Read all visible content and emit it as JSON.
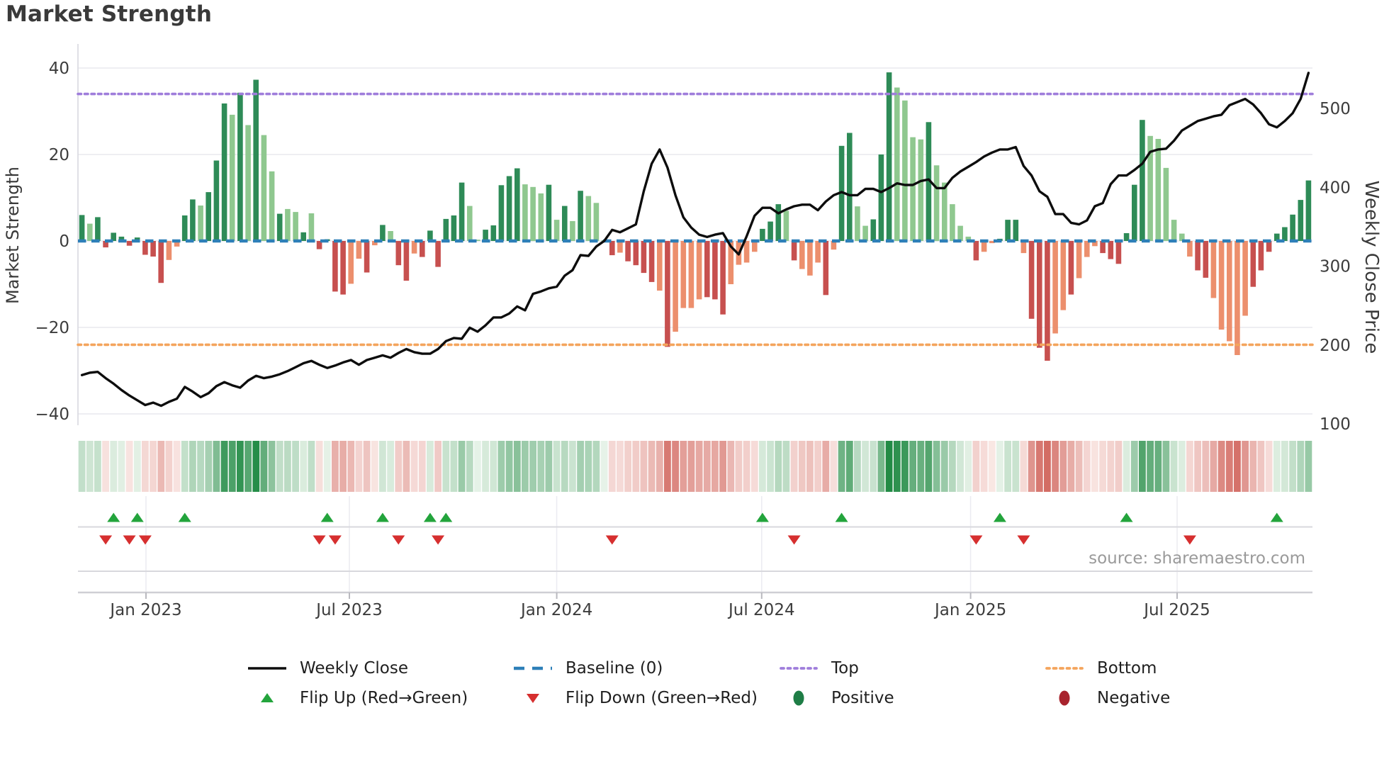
{
  "title": "Market Strength",
  "source": "source: sharemaestro.com",
  "axes": {
    "left_title": "Market Strength",
    "right_title": "Weekly Close Price",
    "left_ticks": [
      40,
      20,
      0,
      -20,
      -40
    ],
    "right_ticks": [
      500,
      400,
      300,
      200,
      100
    ],
    "x_ticks": [
      {
        "week": 8.1,
        "label": "Jan 2023"
      },
      {
        "week": 33.8,
        "label": "Jul 2023"
      },
      {
        "week": 60.0,
        "label": "Jan 2024"
      },
      {
        "week": 85.9,
        "label": "Jul 2024"
      },
      {
        "week": 112.3,
        "label": "Jan 2025"
      },
      {
        "week": 138.4,
        "label": "Jul 2025"
      }
    ]
  },
  "chart_data": {
    "type": "bar",
    "title": "Market Strength",
    "ylabel": "Market Strength",
    "y2label": "Weekly Close Price",
    "ylim": [
      -42.6,
      45.6
    ],
    "y2lim": [
      99,
      584
    ],
    "baseline": 0,
    "top_line": 34,
    "bottom_line": -24,
    "grid": true,
    "legend_position": "bottom",
    "x_start": "Nov 2022",
    "x_end": "Oct 2025",
    "series": [
      {
        "name": "Market Strength (weekly bars)",
        "values": [
          6,
          4,
          5.5,
          -1.5,
          1.9,
          1.0,
          -1.1,
          0.8,
          -3.2,
          -3.6,
          -9.7,
          -4.4,
          -1.3,
          5.9,
          9.6,
          8.2,
          11.3,
          18.6,
          31.8,
          29.2,
          34.3,
          26.8,
          37.3,
          24.5,
          16.1,
          6.3,
          7.4,
          6.7,
          2.0,
          6.4,
          -1.9,
          0.4,
          -11.7,
          -12.4,
          -9.9,
          -4.1,
          -7.3,
          -1.0,
          3.7,
          2.3,
          -5.6,
          -9.2,
          -2.9,
          -3.7,
          2.4,
          -6.0,
          5.1,
          5.9,
          13.5,
          8.1,
          0.3,
          2.6,
          3.6,
          12.9,
          15.0,
          16.8,
          13.1,
          12.5,
          11.0,
          13.0,
          4.9,
          8.1,
          4.6,
          11.6,
          10.4,
          8.8,
          0.2,
          -3.3,
          -2.7,
          -4.7,
          -5.6,
          -7.4,
          -9.5,
          -11.5,
          -24.5,
          -21.0,
          -15.5,
          -15.5,
          -13.5,
          -13.0,
          -13.5,
          -17.0,
          -10.0,
          -5.5,
          -5.0,
          -2.5,
          2.8,
          4.5,
          8.5,
          7.0,
          -4.5,
          -6.5,
          -8.0,
          -5.0,
          -12.5,
          -2.0,
          22.0,
          25.0,
          8.0,
          3.5,
          5.0,
          20.0,
          39.0,
          35.5,
          32.5,
          24.0,
          23.5,
          27.5,
          17.5,
          13.5,
          8.5,
          3.5,
          1.0,
          -4.5,
          -2.5,
          -0.5,
          0.5,
          4.9,
          4.9,
          -2.8,
          -18.0,
          -24.7,
          -27.7,
          -21.4,
          -16.0,
          -12.4,
          -8.6,
          -3.7,
          -1.2,
          -2.8,
          -4.2,
          -5.3,
          1.8,
          13.0,
          28.0,
          24.3,
          23.6,
          16.9,
          4.9,
          1.7,
          -3.6,
          -6.8,
          -8.5,
          -13.2,
          -20.5,
          -23.2,
          -26.4,
          -17.3,
          -10.6,
          -6.8,
          -2.5,
          1.7,
          3.2,
          6.1,
          9.5,
          14.0
        ]
      },
      {
        "name": "Weekly Close",
        "values": [
          162,
          165,
          166,
          158,
          151,
          143,
          136,
          130,
          124,
          127,
          123,
          128,
          132,
          147,
          141,
          134,
          139,
          148,
          153,
          149,
          146,
          155,
          161,
          158,
          160,
          163,
          167,
          172,
          177,
          180,
          175,
          171,
          174,
          178,
          181,
          175,
          181,
          184,
          187,
          184,
          190,
          195,
          191,
          189,
          189,
          195,
          205,
          209,
          208,
          222,
          217,
          225,
          235,
          235,
          240,
          249,
          244,
          265,
          268,
          272,
          274,
          288,
          295,
          314,
          313,
          325,
          332,
          346,
          343,
          348,
          353,
          395,
          430,
          448,
          425,
          390,
          362,
          349,
          340,
          337,
          340,
          342,
          325,
          315,
          338,
          364,
          374,
          374,
          367,
          372,
          376,
          378,
          378,
          371,
          382,
          390,
          394,
          390,
          390,
          398,
          398,
          394,
          399,
          405,
          403,
          403,
          408,
          410,
          399,
          399,
          412,
          420,
          426,
          432,
          439,
          444,
          448,
          448,
          451,
          427,
          415,
          395,
          388,
          366,
          366,
          355,
          353,
          358,
          376,
          380,
          404,
          415,
          415,
          422,
          430,
          445,
          448,
          449,
          459,
          472,
          478,
          484,
          487,
          490,
          492,
          504,
          508,
          512,
          505,
          494,
          480,
          476,
          484,
          494,
          512,
          545
        ]
      }
    ],
    "bar_light_shade": [
      0,
      1,
      0,
      0,
      0,
      0,
      0,
      0,
      0,
      0,
      0,
      1,
      1,
      0,
      0,
      1,
      0,
      0,
      0,
      1,
      0,
      1,
      0,
      1,
      1,
      0,
      1,
      1,
      0,
      1,
      0,
      0,
      0,
      0,
      1,
      1,
      0,
      1,
      0,
      1,
      0,
      0,
      1,
      0,
      0,
      0,
      0,
      0,
      0,
      1,
      1,
      0,
      0,
      0,
      0,
      0,
      1,
      1,
      1,
      0,
      1,
      0,
      1,
      0,
      1,
      1,
      1,
      0,
      1,
      0,
      0,
      0,
      0,
      1,
      0,
      1,
      1,
      1,
      1,
      0,
      0,
      0,
      1,
      1,
      1,
      1,
      0,
      0,
      0,
      1,
      0,
      1,
      1,
      1,
      0,
      1,
      0,
      0,
      1,
      1,
      0,
      0,
      0,
      1,
      1,
      1,
      1,
      0,
      1,
      1,
      1,
      1,
      1,
      0,
      1,
      1,
      0,
      0,
      0,
      1,
      0,
      0,
      0,
      1,
      1,
      0,
      1,
      1,
      1,
      0,
      0,
      0,
      0,
      0,
      0,
      1,
      1,
      1,
      1,
      1,
      1,
      0,
      0,
      1,
      1,
      1,
      1,
      1,
      0,
      0,
      0,
      0,
      0,
      0,
      0,
      0
    ],
    "flip_up_weeks": [
      4,
      7,
      13,
      31,
      38,
      44,
      46,
      86,
      96,
      116,
      132,
      151
    ],
    "flip_down_weeks": [
      3,
      6,
      8,
      30,
      32,
      40,
      45,
      67,
      90,
      113,
      119,
      140
    ],
    "colors": {
      "pos_dark": "#2e8b57",
      "pos_light": "#8fc88f",
      "neg_dark": "#c7504f",
      "neg_light": "#ec8f6d",
      "baseline": "#2d7fb8",
      "top": "#9f7ddb",
      "bottom": "#f4a45c",
      "price_line": "#0d0d0d",
      "flip_up": "#23a43c",
      "flip_down": "#d62f2f",
      "positive": "#1e7d46",
      "negative": "#a8232d",
      "grid": "#e8e8ee",
      "heat_pos_max": "#228b45",
      "heat_neg_max": "#c64239"
    }
  },
  "legend": {
    "items": [
      {
        "label": "Weekly Close",
        "swatch": "line",
        "color": "#0d0d0d"
      },
      {
        "label": "Baseline (0)",
        "swatch": "dashed",
        "color": "#2d7fb8"
      },
      {
        "label": "Top",
        "swatch": "dotted",
        "color": "#9f7ddb"
      },
      {
        "label": "Bottom",
        "swatch": "dotted",
        "color": "#f4a45c"
      },
      {
        "label": "Flip Up (Red→Green)",
        "swatch": "triangle-up",
        "color": "#23a43c"
      },
      {
        "label": "Flip Down (Green→Red)",
        "swatch": "triangle-down",
        "color": "#d62f2f"
      },
      {
        "label": "Positive",
        "swatch": "circle",
        "color": "#1e7d46"
      },
      {
        "label": "Negative",
        "swatch": "circle",
        "color": "#a8232d"
      }
    ]
  }
}
